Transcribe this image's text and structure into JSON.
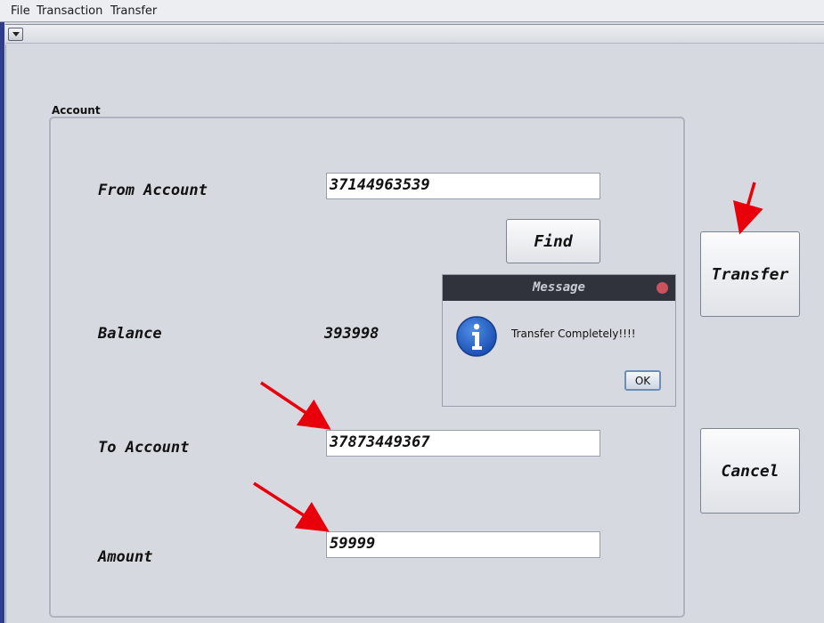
{
  "menu": {
    "items": [
      "File",
      "Transaction",
      "Transfer"
    ]
  },
  "account_group": {
    "title": "Account"
  },
  "form": {
    "from_account_label": "From Account",
    "from_account_value": "37144963539",
    "find_label": "Find",
    "balance_label": "Balance",
    "balance_value": "393998",
    "to_account_label": "To Account",
    "to_account_value": "37873449367",
    "amount_label": "Amount",
    "amount_value": "59999"
  },
  "actions": {
    "transfer_label": "Transfer",
    "cancel_label": "Cancel"
  },
  "dialog": {
    "title": "Message",
    "message": "Transfer Completely!!!!",
    "ok_label": "OK",
    "icon": "info-icon"
  },
  "colors": {
    "annotation_arrow": "#e8000b",
    "dialog_title_bg": "#30333b",
    "info_icon": "#1f5cc7"
  }
}
